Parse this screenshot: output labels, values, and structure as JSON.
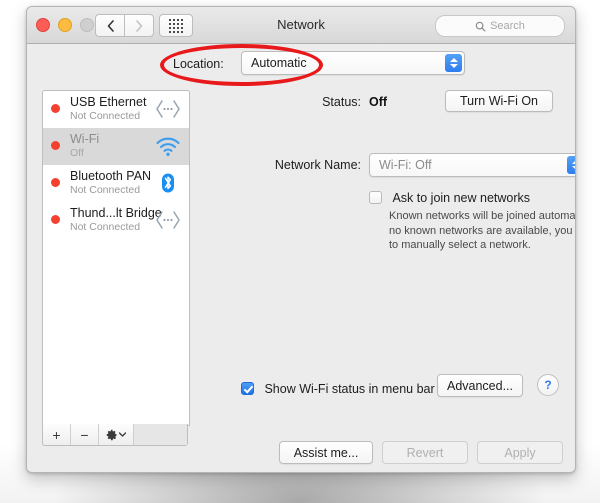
{
  "window": {
    "title": "Network",
    "traffic_lights": [
      "close",
      "minimize",
      "zoom"
    ],
    "nav": {
      "back": "‹",
      "forward": "›"
    },
    "grid_button": "show-all"
  },
  "search": {
    "placeholder": "Search",
    "icon": "search-icon"
  },
  "location": {
    "label": "Location:",
    "value": "Automatic"
  },
  "annotation": {
    "shape": "ellipse",
    "color": "#e8191b",
    "targets": "Location: Automatic"
  },
  "sidebar": {
    "services": [
      {
        "name": "USB Ethernet",
        "status": "Not Connected",
        "icon": "ethernet-icon",
        "dot": "#f4402f",
        "selected": false
      },
      {
        "name": "Wi-Fi",
        "status": "Off",
        "icon": "wifi-icon",
        "dot": "#f4402f",
        "selected": true
      },
      {
        "name": "Bluetooth PAN",
        "status": "Not Connected",
        "icon": "bluetooth-icon",
        "dot": "#f4402f",
        "selected": false
      },
      {
        "name": "Thund...lt Bridge",
        "status": "Not Connected",
        "icon": "ethernet-icon",
        "dot": "#f4402f",
        "selected": false
      }
    ],
    "toolbar": {
      "add": "+",
      "remove": "−",
      "actions": "⚙"
    }
  },
  "main": {
    "status_label": "Status:",
    "status_value": "Off",
    "turn_wifi_button": "Turn Wi-Fi On",
    "network_name_label": "Network Name:",
    "network_name_value": "Wi-Fi: Off",
    "ask_to_join_label": "Ask to join new networks",
    "ask_to_join_checked": false,
    "ask_to_join_help": "Known networks will be joined automatically. If no known networks are available, you will have to manually select a network.",
    "show_status_label": "Show Wi-Fi status in menu bar",
    "show_status_checked": true,
    "advanced_button": "Advanced...",
    "help_button": "?"
  },
  "footer": {
    "assist_me": "Assist me...",
    "revert": "Revert",
    "apply": "Apply"
  }
}
